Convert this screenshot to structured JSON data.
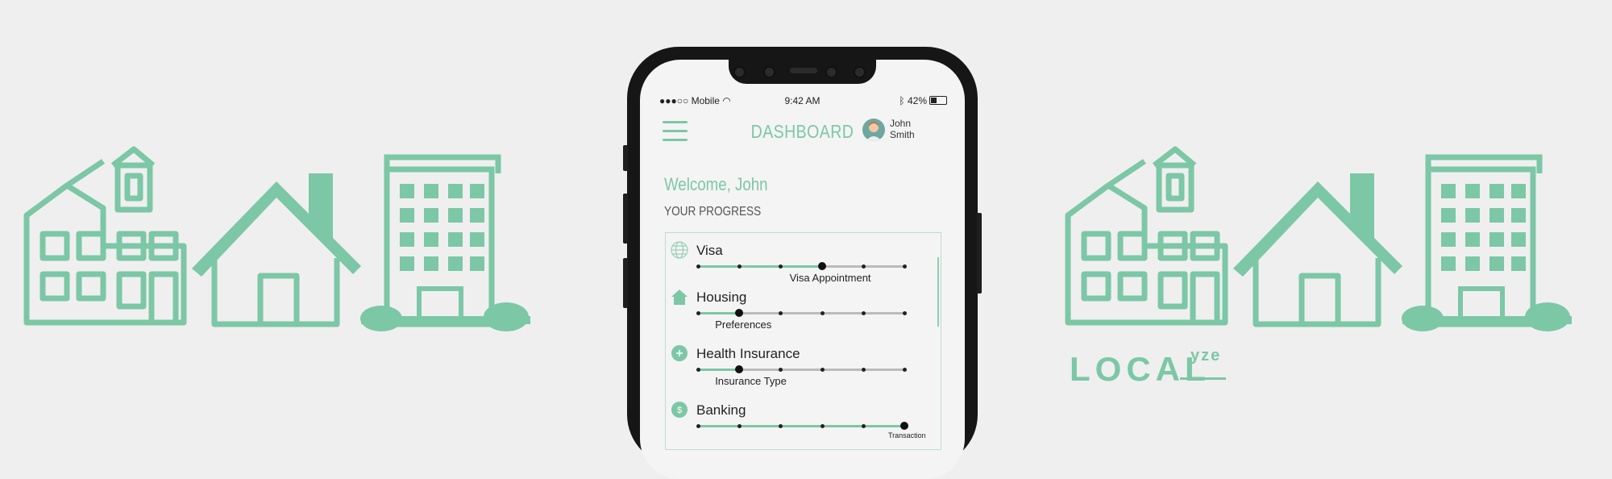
{
  "status_bar": {
    "carrier": "●●●○○ Mobile",
    "time": "9:42 AM",
    "battery": "42%"
  },
  "header": {
    "title": "DASHBOARD",
    "user_first": "John",
    "user_last": "Smith"
  },
  "welcome": "Welcome, John",
  "progress_heading": "YOUR PROGRESS",
  "progress_items": [
    {
      "label": "Visa",
      "icon": "globe-icon",
      "step_label": "Visa Appointment",
      "progress": 0.6
    },
    {
      "label": "Housing",
      "icon": "house-icon",
      "step_label": "Preferences",
      "progress": 0.2
    },
    {
      "label": "Health Insurance",
      "icon": "plus-circle-icon",
      "step_label": "Insurance Type",
      "progress": 0.2
    },
    {
      "label": "Banking",
      "icon": "dollar-circle-icon",
      "step_label": "Transaction",
      "progress": 1.0
    }
  ],
  "logo": {
    "main": "LOCAL",
    "sup": "yze"
  },
  "colors": {
    "accent": "#7cc7a6",
    "background": "#efefef",
    "phone_frame": "#161616"
  }
}
